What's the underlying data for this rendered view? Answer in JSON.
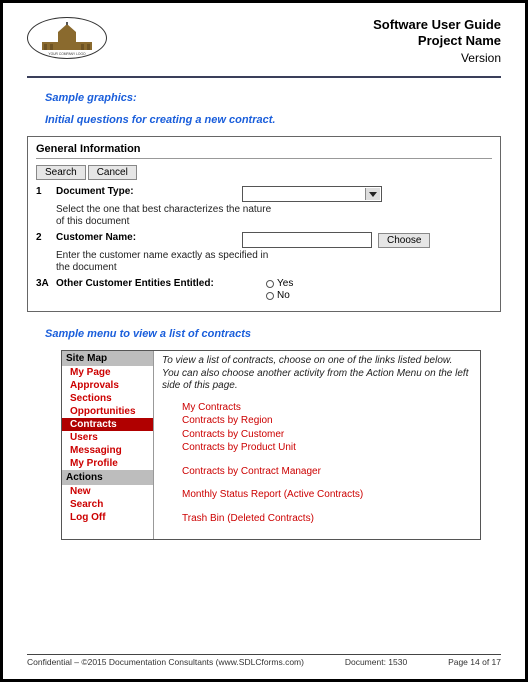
{
  "header": {
    "logo_caption": "YOUR COMPANY LOGO",
    "title": "Software User Guide",
    "project": "Project Name",
    "version": "Version"
  },
  "captions": {
    "sample_graphics": "Sample graphics:",
    "initial_questions": "Initial questions for creating a new contract.",
    "sample_menu": "Sample menu to view a list of contracts"
  },
  "panel": {
    "title": "General Information",
    "search": "Search",
    "cancel": "Cancel",
    "row1_num": "1",
    "row1_label": "Document Type:",
    "row1_help": "Select the one that best characterizes the nature of this document",
    "row2_num": "2",
    "row2_label": "Customer Name:",
    "row2_help": "Enter the customer name exactly as specified in the document",
    "choose": "Choose",
    "row3_num": "3A",
    "row3_label": "Other Customer Entities Entitled:",
    "yes": "Yes",
    "no": "No"
  },
  "menu": {
    "site_map": "Site Map",
    "items": [
      "My Page",
      "Approvals",
      "Sections",
      "Opportunities",
      "Contracts",
      "Users",
      "Messaging",
      "My Profile"
    ],
    "selected_index": 4,
    "actions_hdr": "Actions",
    "actions": [
      "New",
      "Search",
      "Log Off"
    ],
    "intro": "To view a list of contracts, choose on one of the links listed below. You can also choose another activity from the Action Menu on the left side of this page.",
    "links_a": [
      "My Contracts",
      "Contracts by Region",
      "Contracts by Customer",
      "Contracts by Product Unit"
    ],
    "links_b": [
      "Contracts by Contract Manager"
    ],
    "links_c": [
      "Monthly Status Report (Active Contracts)"
    ],
    "links_d": [
      "Trash Bin (Deleted Contracts)"
    ]
  },
  "footer": {
    "left": "Confidential – ©2015 Documentation Consultants (www.SDLCforms.com)",
    "mid": "Document: 1530",
    "right": "Page 14 of 17"
  }
}
